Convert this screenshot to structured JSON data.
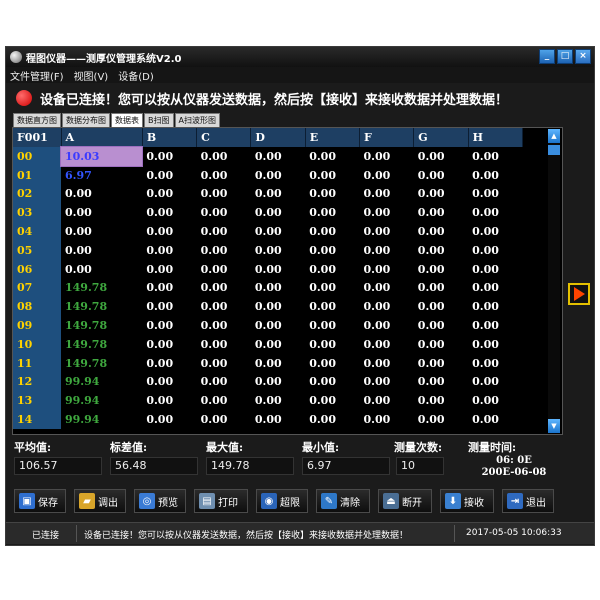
{
  "window": {
    "title": "程图仪器——测厚仪管理系统V2.0",
    "controls": [
      "_",
      "□",
      "×"
    ]
  },
  "menu": [
    "文件管理(F)",
    "视图(V)",
    "设备(D)"
  ],
  "banner": {
    "text": "设备已连接！您可以按从仪器发送数据，然后按【接收】来接收数据并处理数据！"
  },
  "tabs": [
    "数据直方图",
    "数据分布图",
    "数据表",
    "B扫图",
    "A扫波形图"
  ],
  "active_tab": 2,
  "grid": {
    "corner": "F001",
    "columns": [
      "A",
      "B",
      "C",
      "D",
      "E",
      "F",
      "G",
      "H"
    ],
    "rows": [
      {
        "label": "00",
        "cells": [
          "10.03",
          "0.00",
          "0.00",
          "0.00",
          "0.00",
          "0.00",
          "0.00",
          "0.00"
        ]
      },
      {
        "label": "01",
        "cells": [
          "6.97",
          "0.00",
          "0.00",
          "0.00",
          "0.00",
          "0.00",
          "0.00",
          "0.00"
        ]
      },
      {
        "label": "02",
        "cells": [
          "0.00",
          "0.00",
          "0.00",
          "0.00",
          "0.00",
          "0.00",
          "0.00",
          "0.00"
        ]
      },
      {
        "label": "03",
        "cells": [
          "0.00",
          "0.00",
          "0.00",
          "0.00",
          "0.00",
          "0.00",
          "0.00",
          "0.00"
        ]
      },
      {
        "label": "04",
        "cells": [
          "0.00",
          "0.00",
          "0.00",
          "0.00",
          "0.00",
          "0.00",
          "0.00",
          "0.00"
        ]
      },
      {
        "label": "05",
        "cells": [
          "0.00",
          "0.00",
          "0.00",
          "0.00",
          "0.00",
          "0.00",
          "0.00",
          "0.00"
        ]
      },
      {
        "label": "06",
        "cells": [
          "0.00",
          "0.00",
          "0.00",
          "0.00",
          "0.00",
          "0.00",
          "0.00",
          "0.00"
        ]
      },
      {
        "label": "07",
        "cells": [
          "149.78",
          "0.00",
          "0.00",
          "0.00",
          "0.00",
          "0.00",
          "0.00",
          "0.00"
        ]
      },
      {
        "label": "08",
        "cells": [
          "149.78",
          "0.00",
          "0.00",
          "0.00",
          "0.00",
          "0.00",
          "0.00",
          "0.00"
        ]
      },
      {
        "label": "09",
        "cells": [
          "149.78",
          "0.00",
          "0.00",
          "0.00",
          "0.00",
          "0.00",
          "0.00",
          "0.00"
        ]
      },
      {
        "label": "10",
        "cells": [
          "149.78",
          "0.00",
          "0.00",
          "0.00",
          "0.00",
          "0.00",
          "0.00",
          "0.00"
        ]
      },
      {
        "label": "11",
        "cells": [
          "149.78",
          "0.00",
          "0.00",
          "0.00",
          "0.00",
          "0.00",
          "0.00",
          "0.00"
        ]
      },
      {
        "label": "12",
        "cells": [
          "99.94",
          "0.00",
          "0.00",
          "0.00",
          "0.00",
          "0.00",
          "0.00",
          "0.00"
        ]
      },
      {
        "label": "13",
        "cells": [
          "99.94",
          "0.00",
          "0.00",
          "0.00",
          "0.00",
          "0.00",
          "0.00",
          "0.00"
        ]
      },
      {
        "label": "14",
        "cells": [
          "99.94",
          "0.00",
          "0.00",
          "0.00",
          "0.00",
          "0.00",
          "0.00",
          "0.00"
        ]
      }
    ],
    "selected_cell": "00-A",
    "colors": {
      "header": "#1e3f63",
      "rowhead": "#1e4f7e",
      "rowhead_text": "#ffd200",
      "green": "#3fa83f",
      "blue": "#3355ff",
      "selected": "#b98fd0"
    }
  },
  "stats": {
    "mean": {
      "label": "平均值:",
      "value": "106.57"
    },
    "std": {
      "label": "标差值:",
      "value": "56.48"
    },
    "max": {
      "label": "最大值:",
      "value": "149.78"
    },
    "min": {
      "label": "最小值:",
      "value": "6.97"
    },
    "count": {
      "label": "测量次数:",
      "value": "10"
    },
    "time": {
      "label": "测量时间:",
      "line1": "06: 0E",
      "line2": "200E-06-08"
    }
  },
  "toolbar": {
    "save": "保存",
    "load": "调出",
    "preview": "预览",
    "print": "打印",
    "limit": "超限",
    "clear": "清除",
    "disconnect": "断开",
    "receive": "接收",
    "exit": "退出"
  },
  "statusbar": {
    "state": "已连接",
    "message": "设备已连接！您可以按从仪器发送数据，然后按【接收】来接收数据并处理数据！",
    "datetime": "2017-05-05 10:06:33"
  }
}
